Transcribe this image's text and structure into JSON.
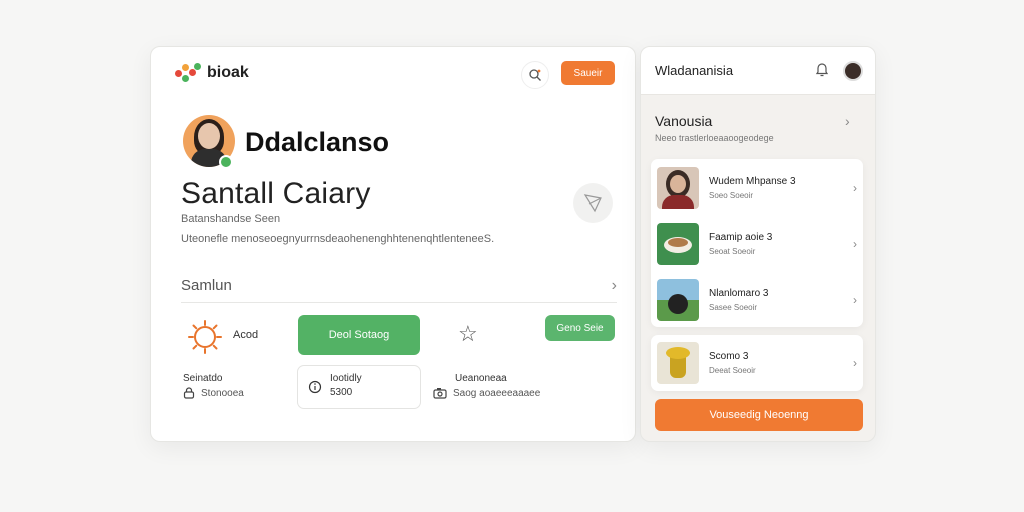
{
  "main": {
    "logo_text": "bioak",
    "header_button": "Saueir",
    "profile_name": "Ddalclanso",
    "big_title": "Santall Caiary",
    "subtitle": "Batanshandse Seen",
    "description": "Uteonefle menoseoegnyurrnsdeaohenenghhtenenqhtlenteneeS.",
    "section_row_label": "Samlun",
    "acod_label": "Acod",
    "green_button": "Deol Sotaog",
    "green_small_button": "Geno Seie",
    "stat_left": {
      "line1": "Seinatdo",
      "line2": "Stonooea"
    },
    "stat_mid": {
      "line1": "Iootidly",
      "line2": "5300"
    },
    "stat_right": {
      "line1": "Ueanoneaa",
      "line2": "Saog aoaeeeaaaee"
    },
    "colors": {
      "orange": "#f07a32",
      "green": "#53b265"
    }
  },
  "side": {
    "title": "Wladananisia",
    "section_title": "Vanousia",
    "section_sub": "Neeo trastlerloeaaoogeodege",
    "items": [
      {
        "title": "Wudem Mhpanse 3",
        "sub": "Soeo Soeoir"
      },
      {
        "title": "Faamip aoie 3",
        "sub": "Seoat Soeoir"
      },
      {
        "title": "Nlanlomaro 3",
        "sub": "Sasee Soeoir"
      },
      {
        "title": "Scomo 3",
        "sub": "Deeat Soeoir"
      }
    ],
    "cta_label": "Vouseedig Neoenng"
  },
  "icons": [
    "logo-icon",
    "search-icon",
    "share-icon",
    "chevron-right-icon",
    "sun-icon",
    "star-icon",
    "lock-icon",
    "info-icon",
    "camera-icon",
    "bell-icon"
  ]
}
